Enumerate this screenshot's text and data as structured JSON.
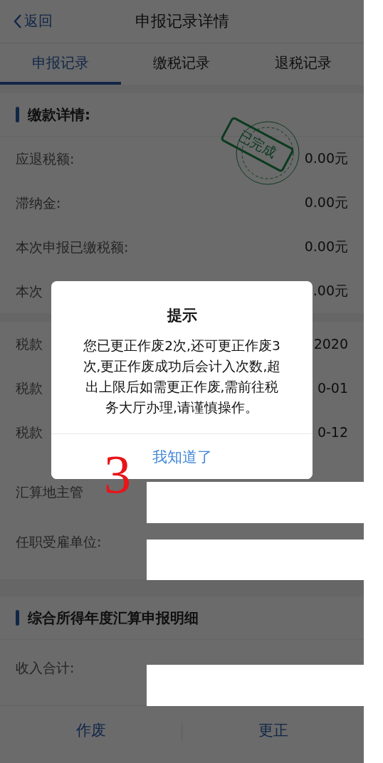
{
  "header": {
    "back": "返回",
    "title": "申报记录详情"
  },
  "tabs": [
    {
      "label": "申报记录",
      "selected": true
    },
    {
      "label": "缴税记录",
      "selected": false
    },
    {
      "label": "退税记录",
      "selected": false
    }
  ],
  "payment_section": {
    "title": "缴款详情:",
    "stamp": "已完成",
    "rows": [
      {
        "label": "应退税额:",
        "value": "0.00元"
      },
      {
        "label": "滞纳金:",
        "value": "0.00元"
      },
      {
        "label": "本次申报已缴税额:",
        "value": "0.00元"
      },
      {
        "label": "本次",
        "value": ".00元"
      }
    ]
  },
  "period_section": {
    "rows": [
      {
        "label": "税款",
        "value": "2020"
      },
      {
        "label": "税款",
        "value": "0-01"
      },
      {
        "label": "税款",
        "value": "0-12"
      },
      {
        "label": "汇算地主管"
      },
      {
        "label": "任职受雇单位:"
      }
    ]
  },
  "income_section": {
    "title": "综合所得年度汇算申报明细",
    "rows": [
      {
        "label": "收入合计:"
      }
    ]
  },
  "bottom_bar": [
    "作废",
    "更正"
  ],
  "dialog": {
    "title": "提示",
    "message_lines": [
      "您已更正作废2次,还可更正作废3",
      "次,更正作废成功后会计入次数,超",
      "出上限后如需更正作废,需前往税",
      "务大厅办理,请谨慎操作。"
    ],
    "button": "我知道了"
  },
  "annotation": "3"
}
